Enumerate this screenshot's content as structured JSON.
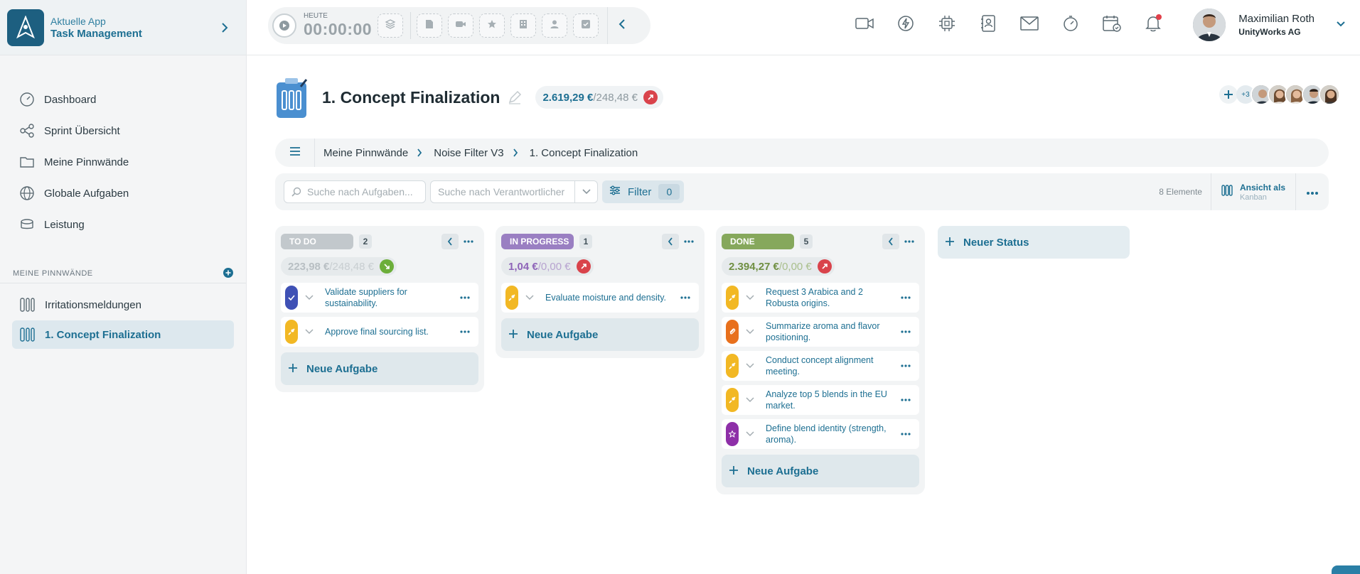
{
  "app": {
    "sub": "Aktuelle App",
    "name": "Task Management"
  },
  "nav": [
    {
      "label": "Dashboard",
      "icon": "gauge-icon"
    },
    {
      "label": "Sprint Übersicht",
      "icon": "flow-icon"
    },
    {
      "label": "Meine Pinnwände",
      "icon": "folder-icon"
    },
    {
      "label": "Globale Aufgaben",
      "icon": "globe-icon"
    },
    {
      "label": "Leistung",
      "icon": "coins-icon"
    }
  ],
  "boards_section": {
    "title": "MEINE PINNWÄNDE"
  },
  "boards": [
    {
      "label": "Irritationsmeldungen"
    },
    {
      "label": "1. Concept Finalization"
    }
  ],
  "timer": {
    "label": "HEUTE",
    "value": "00:00:00"
  },
  "user": {
    "name": "Maximilian Roth",
    "company": "UnityWorks AG"
  },
  "board": {
    "title": "1. Concept Finalization",
    "budget_used": "2.619,29 €",
    "budget_total": "/248,48 €",
    "members_more": "+3"
  },
  "breadcrumb": [
    "Meine Pinnwände",
    "Noise Filter V3",
    "1. Concept Finalization"
  ],
  "toolbar": {
    "search_placeholder": "Suche nach Aufgaben...",
    "assignee_placeholder": "Suche nach Verantwortlicher",
    "filter_label": "Filter",
    "filter_count": "0",
    "elements": "8 Elemente",
    "view_label": "Ansicht als",
    "view_value": "Kanban"
  },
  "columns": [
    {
      "name": "TO DO",
      "count": "2",
      "color": "#c2c8cc",
      "budget_used": "223,98 €",
      "budget_total": "/248,48 €",
      "tasks": [
        {
          "title": "Validate suppliers for sustainability.",
          "type": "check-icon",
          "color": "#3f51b5"
        },
        {
          "title": "Approve final sourcing list.",
          "type": "pin-icon",
          "color": "#f2b824"
        }
      ],
      "new_task": "Neue Aufgabe"
    },
    {
      "name": "IN PROGRESS",
      "count": "1",
      "color": "#9a7fc2",
      "budget_used": "1,04 €",
      "budget_total": "/0,00 €",
      "tasks": [
        {
          "title": "Evaluate moisture and density.",
          "type": "pin-icon",
          "color": "#f2b824"
        }
      ],
      "new_task": "Neue Aufgabe"
    },
    {
      "name": "DONE",
      "count": "5",
      "color": "#86a85c",
      "budget_used": "2.394,27 €",
      "budget_total": "/0,00 €",
      "tasks": [
        {
          "title": "Request 3 Arabica and 2 Robusta origins.",
          "type": "pin-icon",
          "color": "#f2b824"
        },
        {
          "title": "Summarize aroma and flavor positioning.",
          "type": "paperclip-icon",
          "color": "#e8701d"
        },
        {
          "title": "Conduct concept alignment meeting.",
          "type": "pin-icon",
          "color": "#f2b824"
        },
        {
          "title": "Analyze top 5 blends in the EU market.",
          "type": "pin-icon",
          "color": "#f2b824"
        },
        {
          "title": "Define blend identity (strength, aroma).",
          "type": "star-icon",
          "color": "#8e2fa8"
        }
      ],
      "new_task": "Neue Aufgabe"
    }
  ],
  "new_status": "Neuer Status"
}
